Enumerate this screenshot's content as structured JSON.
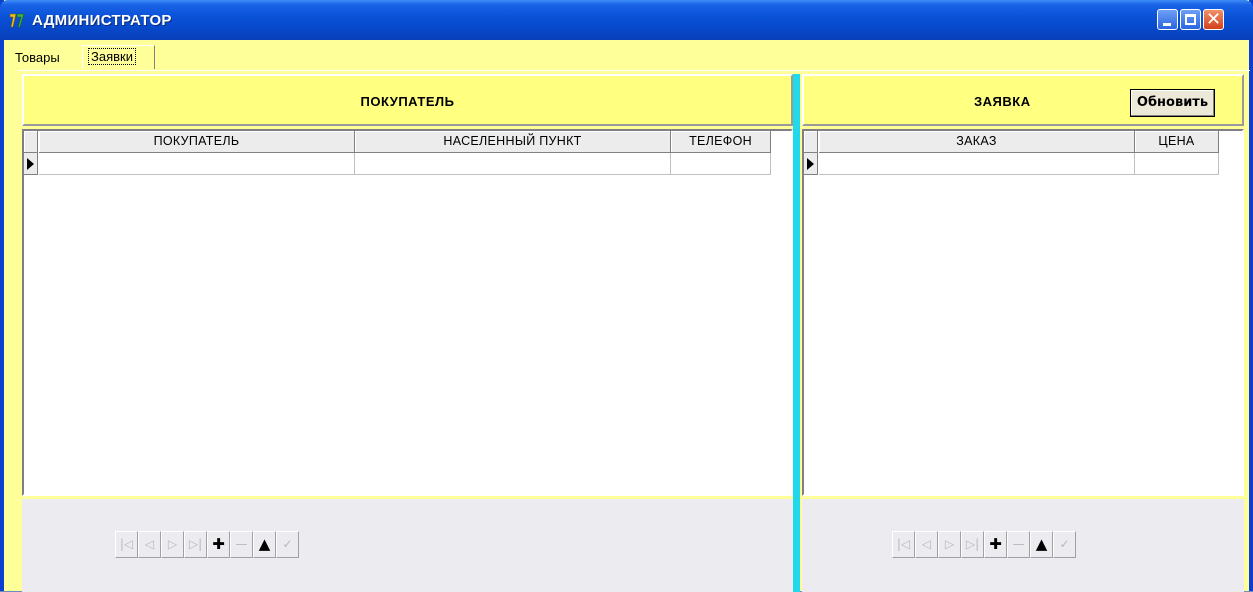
{
  "window": {
    "title": "АДМИНИСТРАТОР"
  },
  "tabs": [
    {
      "label": "Товары"
    },
    {
      "label": "Заявки"
    }
  ],
  "left_panel": {
    "header_title": "ПОКУПАТЕЛЬ",
    "columns": [
      "ПОКУПАТЕЛЬ",
      "НАСЕЛЕННЫЙ ПУНКТ",
      "ТЕЛЕФОН"
    ]
  },
  "right_panel": {
    "header_title": "ЗАЯВКА",
    "refresh_label": "Обновить",
    "columns": [
      "ЗАКАЗ",
      "ЦЕНА"
    ]
  },
  "navigator": {
    "buttons": [
      {
        "icon": "first-record-icon",
        "glyph": "|◁"
      },
      {
        "icon": "prior-record-icon",
        "glyph": "◁"
      },
      {
        "icon": "next-record-icon",
        "glyph": "▷"
      },
      {
        "icon": "last-record-icon",
        "glyph": "▷|"
      },
      {
        "icon": "insert-record-icon",
        "glyph": "✚"
      },
      {
        "icon": "delete-record-icon",
        "glyph": "—"
      },
      {
        "icon": "edit-record-icon",
        "glyph": "▲"
      },
      {
        "icon": "post-record-icon",
        "glyph": "✓"
      }
    ]
  },
  "colors": {
    "title_bar": "#0a52d8",
    "background": "#ffff99",
    "panel_header": "#ffff80",
    "divider": "#22d9ec"
  }
}
